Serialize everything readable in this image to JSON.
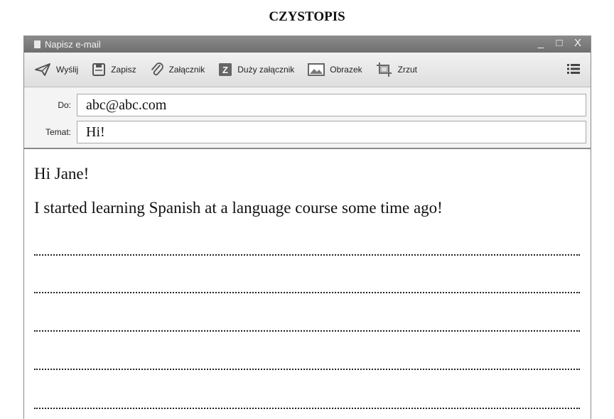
{
  "page_title": "CZYSTOPIS",
  "window": {
    "title": "Napisz e-mail",
    "controls": {
      "minimize": "_",
      "maximize": "□",
      "close": "X"
    }
  },
  "toolbar": {
    "send": "Wyślij",
    "save": "Zapisz",
    "attachment": "Załącznik",
    "large_attachment": "Duży załącznik",
    "image": "Obrazek",
    "screenshot": "Zrzut"
  },
  "fields": {
    "to_label": "Do:",
    "to_value": "abc@abc.com",
    "subject_label": "Temat:",
    "subject_value": "Hi!"
  },
  "message": {
    "greeting": "Hi Jane!",
    "first_sentence": "I started learning Spanish at a language course some time ago!",
    "blank_lines": 5
  }
}
